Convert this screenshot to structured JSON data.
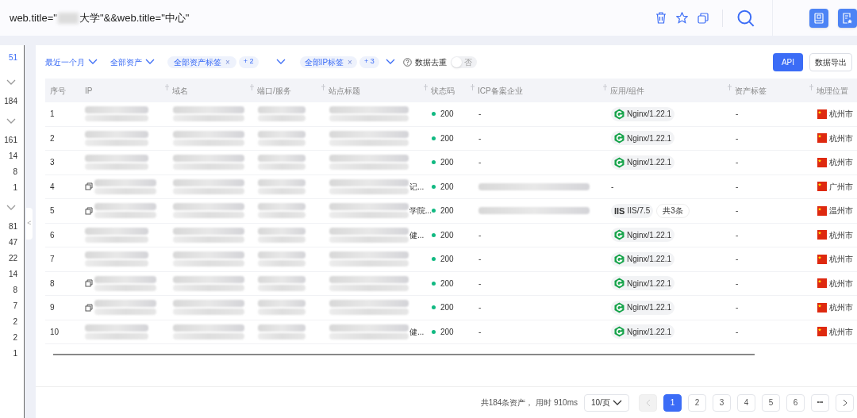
{
  "search": {
    "prefix": "web.title=\"",
    "suffix": "大学\"&&web.title=\"中心\""
  },
  "sidebar": {
    "counts": [
      {
        "kind": "count",
        "label": "51",
        "selected": true
      },
      {
        "kind": "chevron"
      },
      {
        "kind": "count",
        "label": "184",
        "selected": false
      },
      {
        "kind": "chevron"
      },
      {
        "kind": "count",
        "label": "161",
        "selected": false
      },
      {
        "kind": "count",
        "label": "14",
        "selected": false
      },
      {
        "kind": "count",
        "label": "8",
        "selected": false
      },
      {
        "kind": "count",
        "label": "1",
        "selected": false
      },
      {
        "kind": "chevron"
      },
      {
        "kind": "count",
        "label": "81",
        "selected": false
      },
      {
        "kind": "count",
        "label": "47",
        "selected": false
      },
      {
        "kind": "count",
        "label": "22",
        "selected": false
      },
      {
        "kind": "count",
        "label": "14",
        "selected": false
      },
      {
        "kind": "count",
        "label": "8",
        "selected": false
      },
      {
        "kind": "count",
        "label": "7",
        "selected": false
      },
      {
        "kind": "count",
        "label": "2",
        "selected": false
      },
      {
        "kind": "count",
        "label": "2",
        "selected": false
      },
      {
        "kind": "count",
        "label": "1",
        "selected": false
      }
    ],
    "collapse": "<"
  },
  "filters": {
    "time": "最近一个月",
    "assets": "全部资产",
    "asset_tags": {
      "label": "全部资产标签",
      "remove": "×",
      "more": "+ 2"
    },
    "ip_tags": {
      "label": "全部IP标签",
      "remove": "×",
      "more": "+ 3"
    },
    "dedup": {
      "label": "数据去重",
      "on": false,
      "state": "否"
    },
    "buttons": [
      "API",
      "数据导出"
    ]
  },
  "table": {
    "columns": [
      "序号",
      "IP",
      "域名",
      "端口/服务",
      "站点标题",
      "状态码",
      "ICP备案企业",
      "应用/组件",
      "资产标签",
      "地理位置"
    ],
    "rows": [
      {
        "index": "1",
        "ip_icon": false,
        "title_tail": "",
        "status": "200",
        "icp": "-",
        "app": {
          "kind": "nginx",
          "label": "Nginx/1.22.1"
        },
        "tag": "-",
        "location": "杭州市"
      },
      {
        "index": "2",
        "ip_icon": false,
        "title_tail": "",
        "status": "200",
        "icp": "-",
        "app": {
          "kind": "nginx",
          "label": "Nginx/1.22.1"
        },
        "tag": "-",
        "location": "杭州市"
      },
      {
        "index": "3",
        "ip_icon": false,
        "title_tail": "",
        "status": "200",
        "icp": "-",
        "app": {
          "kind": "nginx",
          "label": "Nginx/1.22.1"
        },
        "tag": "-",
        "location": "杭州市"
      },
      {
        "index": "4",
        "ip_icon": true,
        "title_tail": "记...",
        "status": "200",
        "icp": "",
        "app": {
          "kind": "none",
          "label": "-"
        },
        "tag": "-",
        "location": "广州市"
      },
      {
        "index": "5",
        "ip_icon": true,
        "title_tail": "学院...",
        "status": "200",
        "icp": "",
        "app": {
          "kind": "iis",
          "logo": "IIS",
          "label": "IIS/7.5",
          "extra": "共3条"
        },
        "tag": "-",
        "location": "温州市"
      },
      {
        "index": "6",
        "ip_icon": false,
        "title_tail": "健...",
        "status": "200",
        "icp": "-",
        "app": {
          "kind": "nginx",
          "label": "Nginx/1.22.1"
        },
        "tag": "-",
        "location": "杭州市"
      },
      {
        "index": "7",
        "ip_icon": false,
        "title_tail": "",
        "status": "200",
        "icp": "-",
        "app": {
          "kind": "nginx",
          "label": "Nginx/1.22.1"
        },
        "tag": "-",
        "location": "杭州市"
      },
      {
        "index": "8",
        "ip_icon": true,
        "title_tail": "",
        "status": "200",
        "icp": "-",
        "app": {
          "kind": "nginx",
          "label": "Nginx/1.22.1"
        },
        "tag": "-",
        "location": "杭州市"
      },
      {
        "index": "9",
        "ip_icon": true,
        "title_tail": "",
        "status": "200",
        "icp": "-",
        "app": {
          "kind": "nginx",
          "label": "Nginx/1.22.1"
        },
        "tag": "-",
        "location": "杭州市"
      },
      {
        "index": "10",
        "ip_icon": false,
        "title_tail": "健...",
        "status": "200",
        "icp": "-",
        "app": {
          "kind": "nginx",
          "label": "Nginx/1.22.1"
        },
        "tag": "-",
        "location": "杭州市"
      }
    ]
  },
  "pagination": {
    "summary": "共184条资产， 用时 910ms",
    "page_size": "10/页",
    "prev_disabled": true,
    "pages": [
      {
        "label": "1",
        "selected": true
      },
      {
        "label": "2",
        "selected": false
      },
      {
        "label": "3",
        "selected": false
      },
      {
        "label": "4",
        "selected": false
      },
      {
        "label": "5",
        "selected": false
      },
      {
        "label": "6",
        "selected": false
      }
    ],
    "more": "•••"
  }
}
